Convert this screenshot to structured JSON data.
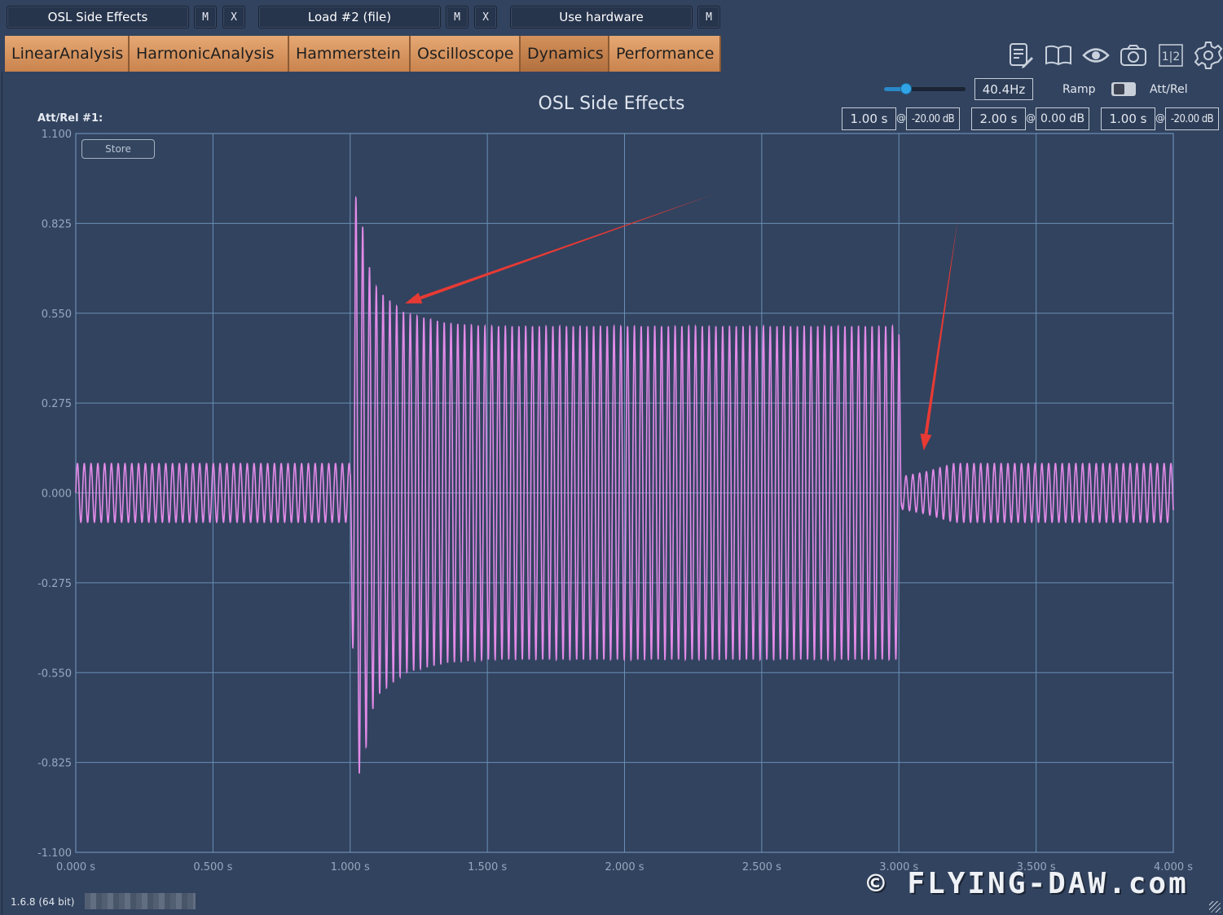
{
  "slots": [
    {
      "name": "OSL Side Effects",
      "m": "M",
      "x": "X"
    },
    {
      "name": "Load #2 (file)",
      "m": "M",
      "x": "X"
    },
    {
      "name": "Use hardware",
      "m": "M"
    }
  ],
  "tabs": [
    {
      "label": "LinearAnalysis"
    },
    {
      "label": "HarmonicAnalysis"
    },
    {
      "label": "Hammerstein"
    },
    {
      "label": "Oscilloscope"
    },
    {
      "label": "Dynamics",
      "active": true
    },
    {
      "label": "Performance"
    }
  ],
  "toolbar_icons": [
    "notes-edit-icon",
    "book-icon",
    "eye-icon",
    "camera-icon",
    "compare-1-2-icon",
    "gear-icon"
  ],
  "toolbar_compare_text": "1|2",
  "controls": {
    "frequency": "40.4Hz",
    "slider_value": 0.27,
    "ramp_label": "Ramp",
    "attrel_label": "Att/Rel",
    "attrel_left_label": "Att/Rel #1:",
    "store_label": "Store",
    "at_sign": "@",
    "segments": [
      {
        "time": "1.00 s",
        "level": "-20.00 dB"
      },
      {
        "time": "2.00 s",
        "level": "0.00 dB"
      },
      {
        "time": "1.00 s",
        "level": "-20.00 dB"
      }
    ]
  },
  "footer": {
    "version": "1.6.8 (64 bit)",
    "watermark": "© FLYING-DAW.com"
  },
  "annotation_color": "#e83a34",
  "chart_data": {
    "type": "line",
    "title": "OSL Side Effects",
    "xlabel": "",
    "ylabel": "",
    "xlim": [
      0,
      4
    ],
    "ylim": [
      -1.1,
      1.1
    ],
    "grid": true,
    "xticks": [
      "0.000 s",
      "0.500 s",
      "1.000 s",
      "1.500 s",
      "2.000 s",
      "2.500 s",
      "3.000 s",
      "3.500 s",
      "4.000 s"
    ],
    "yticks": [
      "1.100",
      "0.825",
      "0.550",
      "0.275",
      "0.000",
      "-0.275",
      "-0.550",
      "-0.825",
      "-1.100"
    ],
    "line_color": "#e38be8",
    "frequency_hz": 40.4,
    "envelope": {
      "t": [
        0.0,
        1.0,
        1.02,
        1.05,
        1.1,
        1.2,
        1.35,
        1.5,
        3.0,
        3.01,
        3.1,
        3.2,
        4.0
      ],
      "amplitude": [
        0.09,
        0.09,
        0.84,
        0.74,
        0.62,
        0.55,
        0.52,
        0.51,
        0.51,
        0.05,
        0.065,
        0.09,
        0.09
      ]
    },
    "annotations": [
      {
        "type": "arrow",
        "points_to_t": 1.2,
        "points_to_y": 0.58
      },
      {
        "type": "arrow",
        "points_to_t": 3.09,
        "points_to_y": 0.13
      }
    ]
  }
}
